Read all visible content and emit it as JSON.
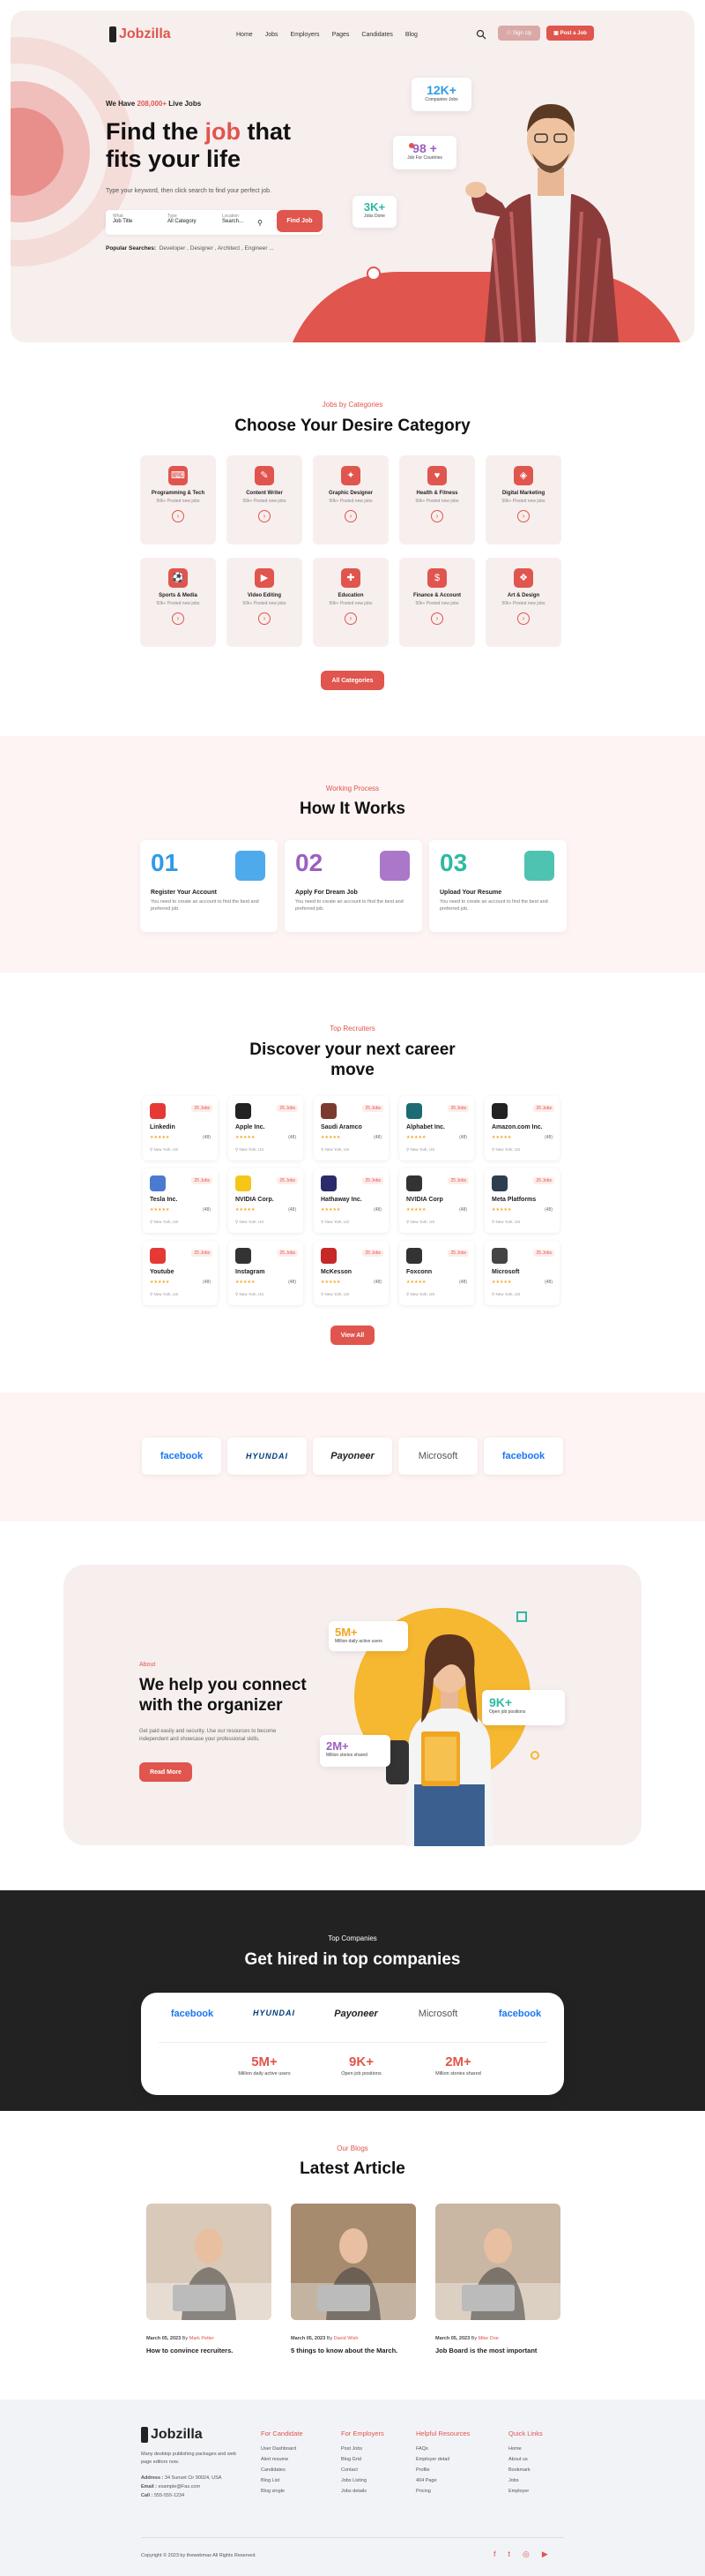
{
  "nav": {
    "logo": "Jobzilla",
    "items": [
      "Home",
      "Jobs",
      "Employers",
      "Pages",
      "Candidates",
      "Blog"
    ],
    "signup": "Sign Up",
    "post_job": "Post a Job"
  },
  "hero": {
    "live_prefix": "We Have ",
    "live_count": "208,000+",
    "live_suffix": " Live Jobs",
    "title_a": "Find the ",
    "title_b": "job",
    "title_c": " that",
    "title_d": "fits your life",
    "subtitle": "Type your keyword, then click search to find your perfect job.",
    "what_label": "What",
    "what_value": "Job Title",
    "type_label": "Type",
    "type_value": "All Category",
    "location_label": "Location",
    "location_value": "Search...",
    "find_button": "Find Job",
    "popular_label": "Popular Searches:",
    "popular_values": "Developer , Designer , Architect , Engineer ...",
    "stat1_value": "12K+",
    "stat1_label": "Companies Jobs",
    "stat2_value": "98 +",
    "stat2_label": "Job For Countries",
    "stat3_value": "3K+",
    "stat3_label": "Jobs Done"
  },
  "categories": {
    "eyebrow": "Jobs by Categories",
    "title": "Choose Your Desire Category",
    "items": [
      {
        "name": "Programming & Tech",
        "sub": "50k+ Posted new jobs"
      },
      {
        "name": "Content Writer",
        "sub": "50k+ Posted new jobs"
      },
      {
        "name": "Graphic Designer",
        "sub": "50k+ Posted new jobs"
      },
      {
        "name": "Health & Fitness",
        "sub": "50k+ Posted new jobs"
      },
      {
        "name": "Digital Marketing",
        "sub": "50k+ Posted new jobs"
      },
      {
        "name": "Sports & Media",
        "sub": "50k+ Posted new jobs"
      },
      {
        "name": "Video Editing",
        "sub": "50k+ Posted new jobs"
      },
      {
        "name": "Education",
        "sub": "50k+ Posted new jobs"
      },
      {
        "name": "Finance & Account",
        "sub": "50k+ Posted new jobs"
      },
      {
        "name": "Art & Design",
        "sub": "50k+ Posted new jobs"
      }
    ],
    "button": "All Categories"
  },
  "how": {
    "eyebrow": "Working Process",
    "title": "How It Works",
    "steps": [
      {
        "num": "01",
        "title": "Register Your Account",
        "desc": "You need to create an account to find the best and preferred job.",
        "color": "#2f9be7"
      },
      {
        "num": "02",
        "title": "Apply For Dream Job",
        "desc": "You need to create an account to find the best and preferred job.",
        "color": "#9b5fc0"
      },
      {
        "num": "03",
        "title": "Upload Your Resume",
        "desc": "You need to create an account to find the best and preferred job.",
        "color": "#2fb9a3"
      }
    ]
  },
  "recruiters": {
    "eyebrow": "Top Recruiters",
    "title_a": "Discover your next career",
    "title_b": "move",
    "items": [
      {
        "name": "Linkedin",
        "jobs": "25 Jobs",
        "count": "(48)",
        "loc": "New York, US",
        "color": "#e53935"
      },
      {
        "name": "Apple Inc.",
        "jobs": "25 Jobs",
        "count": "(48)",
        "loc": "New York, US",
        "color": "#222222"
      },
      {
        "name": "Saudi Aramco",
        "jobs": "25 Jobs",
        "count": "(48)",
        "loc": "New York, US",
        "color": "#7a3b2e"
      },
      {
        "name": "Alphabet Inc.",
        "jobs": "25 Jobs",
        "count": "(48)",
        "loc": "New York, US",
        "color": "#1c6b74"
      },
      {
        "name": "Amazon.com Inc.",
        "jobs": "25 Jobs",
        "count": "(48)",
        "loc": "New York, US",
        "color": "#222222"
      },
      {
        "name": "Tesla Inc.",
        "jobs": "25 Jobs",
        "count": "(48)",
        "loc": "New York, US",
        "color": "#4a7bd0"
      },
      {
        "name": "NVIDIA Corp.",
        "jobs": "25 Jobs",
        "count": "(48)",
        "loc": "New York, US",
        "color": "#f5c518"
      },
      {
        "name": "Hathaway Inc.",
        "jobs": "25 Jobs",
        "count": "(48)",
        "loc": "New York, US",
        "color": "#2b2b6b"
      },
      {
        "name": "NVIDIA Corp",
        "jobs": "25 Jobs",
        "count": "(48)",
        "loc": "New York, US",
        "color": "#333333"
      },
      {
        "name": "Meta Platforms",
        "jobs": "25 Jobs",
        "count": "(48)",
        "loc": "New York, US",
        "color": "#2c3e50"
      },
      {
        "name": "Youtube",
        "jobs": "25 Jobs",
        "count": "(48)",
        "loc": "New York, US",
        "color": "#e53935"
      },
      {
        "name": "Instagram",
        "jobs": "25 Jobs",
        "count": "(48)",
        "loc": "New York, US",
        "color": "#333333"
      },
      {
        "name": "McKesson",
        "jobs": "25 Jobs",
        "count": "(48)",
        "loc": "New York, US",
        "color": "#c62828"
      },
      {
        "name": "Foxconn",
        "jobs": "25 Jobs",
        "count": "(48)",
        "loc": "New York, US",
        "color": "#333333"
      },
      {
        "name": "Microsoft",
        "jobs": "25 Jobs",
        "count": "(48)",
        "loc": "New York, US",
        "color": "#444444"
      }
    ],
    "stars": "★★★★★",
    "button": "View All"
  },
  "logos": [
    "facebook",
    "HYUNDAI",
    "Payoneer",
    "Microsoft",
    "facebook"
  ],
  "about": {
    "eyebrow": "About",
    "title_a": "We help you connect",
    "title_b": "with the organizer",
    "desc": "Get paid easily and security. Use our resources to become independent and showcase your professional skills.",
    "button": "Read More",
    "stat1_value": "5M+",
    "stat1_label": "Million daily active users",
    "stat2_value": "9K+",
    "stat2_label": "Open job positions",
    "stat3_value": "2M+",
    "stat3_label": "Million stories shared"
  },
  "top_companies": {
    "eyebrow": "Top Companies",
    "title": "Get hired in top companies",
    "stats": [
      {
        "value": "5M+",
        "label": "Million daily active users"
      },
      {
        "value": "9K+",
        "label": "Open job positions"
      },
      {
        "value": "2M+",
        "label": "Million stories shared"
      }
    ]
  },
  "blog": {
    "eyebrow": "Our Blogs",
    "title": "Latest Article",
    "posts": [
      {
        "date": "March 05, 2023",
        "by": "By",
        "author": "Mark Petter",
        "title": "How to convince recruiters."
      },
      {
        "date": "March 05, 2023",
        "by": "By",
        "author": "David Wish",
        "title": "5 things to know about the March."
      },
      {
        "date": "March 05, 2023",
        "by": "By",
        "author": "Mike Doe",
        "title": "Job Board is the most important"
      }
    ]
  },
  "footer": {
    "logo": "Jobzilla",
    "desc": "Many desktop publishing packages and web page editors now.",
    "address_label": "Address :",
    "address": "34 Sunset Cir 90024, USA",
    "email_label": "Email :",
    "email": "example@Fax.com",
    "call_label": "Call :",
    "call": "555-555-1234",
    "cols": [
      {
        "title": "For Candidate",
        "items": [
          "User Dashboard",
          "Alert resume",
          "Candidates",
          "Blog List",
          "Blog single"
        ]
      },
      {
        "title": "For Employers",
        "items": [
          "Post Jobs",
          "Blog Grid",
          "Contact",
          "Jobs Listing",
          "Jobs details"
        ]
      },
      {
        "title": "Helpful Resources",
        "items": [
          "FAQs",
          "Employer detail",
          "Profile",
          "404 Page",
          "Pricing"
        ]
      },
      {
        "title": "Quick Links",
        "items": [
          "Home",
          "About us",
          "Bookmark",
          "Jobs",
          "Employer"
        ]
      }
    ],
    "copyright": "Copyright © 2023 by thewebmax All Rights Reserved."
  }
}
